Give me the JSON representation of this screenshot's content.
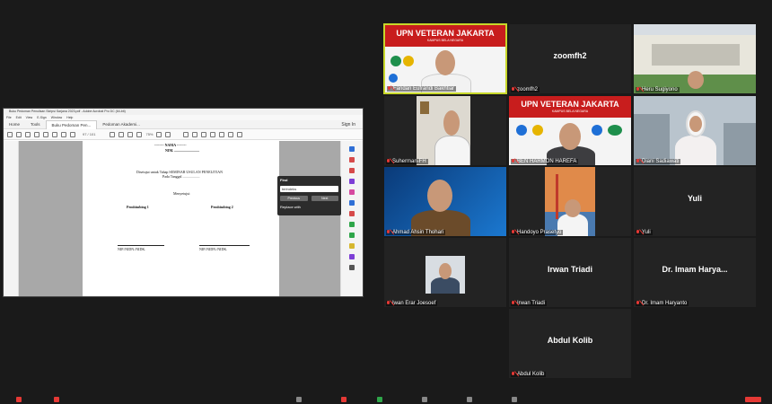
{
  "share": {
    "window_title": "Buku Pedoman Penulisan Skripsi Sarjana 2023.pdf - Adobe Acrobat Pro DC (64-bit)",
    "menu": [
      "File",
      "Edit",
      "View",
      "E-Sign",
      "Window",
      "Help"
    ],
    "tabs": [
      "Home",
      "Tools",
      "Buku Pedoman Pen...",
      "Pedoman Akademi..."
    ],
    "sign_in": "Sign In",
    "page_indicator": "97 / 101",
    "zoom": "75%",
    "page": {
      "name_label": "-------- NAMA --------",
      "nim_label": "NIM. ............................",
      "line1": "Disetujui untuk Tahap SEMINAR USULAN PENELITIAN",
      "line2": "Pada Tanggal ...................",
      "menyetujui": "Menyetujui",
      "pembimbing1": "Pembimbing 1",
      "pembimbing2": "Pembimbing 2",
      "sign1": "NIP./NIDN./NIDK.",
      "sign2": "NIP./NIDN./NIDK."
    },
    "find": {
      "title": "Find",
      "query": "terindeks",
      "previous": "Previous",
      "next": "Next",
      "replace": "Replace with"
    }
  },
  "participants": [
    {
      "name": "Fandan Eufrandi Bakhtiar",
      "type": "video",
      "active": true
    },
    {
      "name": "zoomfh2",
      "type": "name",
      "display": "zoomfh2"
    },
    {
      "name": "Heru Sugiyono",
      "type": "video"
    },
    {
      "name": "Suherman-FH",
      "type": "video"
    },
    {
      "name": "BEN HARMON HAREFA",
      "type": "video"
    },
    {
      "name": "Diani Sadiawati",
      "type": "video"
    },
    {
      "name": "Ahmad Ahsin Thohari",
      "type": "video"
    },
    {
      "name": "Handoyo Prasetyo",
      "type": "video"
    },
    {
      "name": "Yuli",
      "type": "name",
      "display": "Yuli"
    },
    {
      "name": "Iwan Erar Joesoef",
      "type": "video"
    },
    {
      "name": "Irwan Triadi",
      "type": "name",
      "display": "Irwan Triadi"
    },
    {
      "name": "Dr. Imam Haryanto",
      "type": "name",
      "display": "Dr. Imam Harya..."
    },
    {
      "name": "Abdul Kolib",
      "type": "name",
      "display": "Abdul Kolib"
    }
  ],
  "banner": {
    "title": "UPN VETERAN JAKARTA",
    "subtitle": "KAMPUS BELA NEGARA"
  },
  "colors": {
    "background": "#1a1a1a",
    "tile": "#232323",
    "active_border": "#c7d72a",
    "banner_red": "#c81d1d",
    "muted_red": "#e53935"
  }
}
